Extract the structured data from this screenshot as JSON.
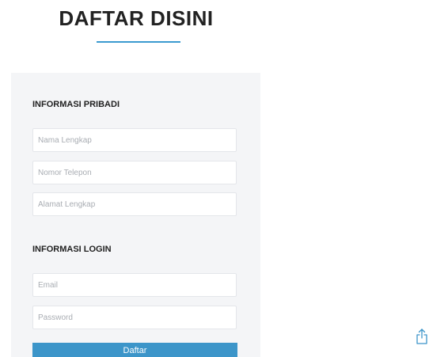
{
  "header": {
    "title": "DAFTAR DISINI"
  },
  "form": {
    "personal_section_title": "INFORMASI PRIBADI",
    "login_section_title": "INFORMASI LOGIN",
    "fields": {
      "full_name_placeholder": "Nama Lengkap",
      "phone_placeholder": "Nomor Telepon",
      "address_placeholder": "Alamat Lengkap",
      "email_placeholder": "Email",
      "password_placeholder": "Password"
    },
    "submit_label": "Daftar"
  },
  "icons": {
    "share": "share-icon"
  },
  "colors": {
    "accent": "#3c95c9",
    "panel_background": "#f4f5f7",
    "title_text": "#222222"
  }
}
